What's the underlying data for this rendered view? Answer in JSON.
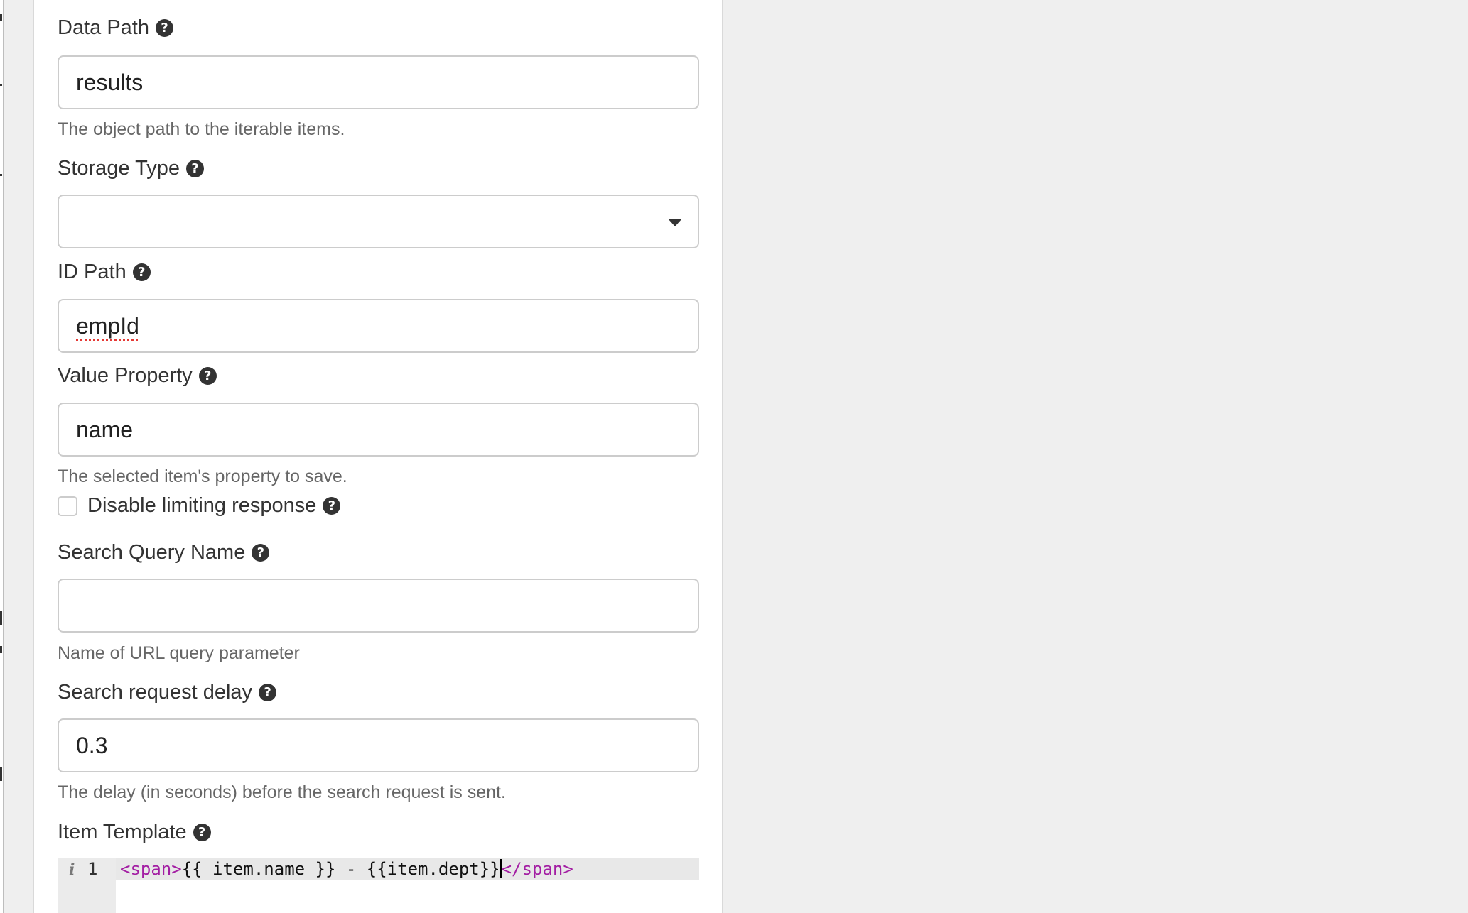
{
  "form": {
    "data_path": {
      "label": "Data Path",
      "value": "results",
      "hint": "The object path to the iterable items."
    },
    "storage_type": {
      "label": "Storage Type",
      "value": ""
    },
    "id_path": {
      "label": "ID Path",
      "value": "empId"
    },
    "value_property": {
      "label": "Value Property",
      "value": "name",
      "hint": "The selected item's property to save."
    },
    "disable_limiting": {
      "label": "Disable limiting response",
      "checked": false
    },
    "search_query_name": {
      "label": "Search Query Name",
      "value": "",
      "hint": "Name of URL query parameter"
    },
    "search_request_delay": {
      "label": "Search request delay",
      "value": "0.3",
      "hint": "The delay (in seconds) before the search request is sent."
    },
    "item_template": {
      "label": "Item Template",
      "line_number": "1",
      "code_open_tag": "<span>",
      "code_body": "{{ item.name }} - {{item.dept}}",
      "code_close_tag": "</span>"
    }
  },
  "icons": {
    "help": "?",
    "info": "i"
  },
  "colors": {
    "background": "#efefef",
    "panel": "#ffffff",
    "input_border": "#cccccc",
    "label": "#333333",
    "hint": "#666666",
    "code_tag": "#a31ea3"
  }
}
